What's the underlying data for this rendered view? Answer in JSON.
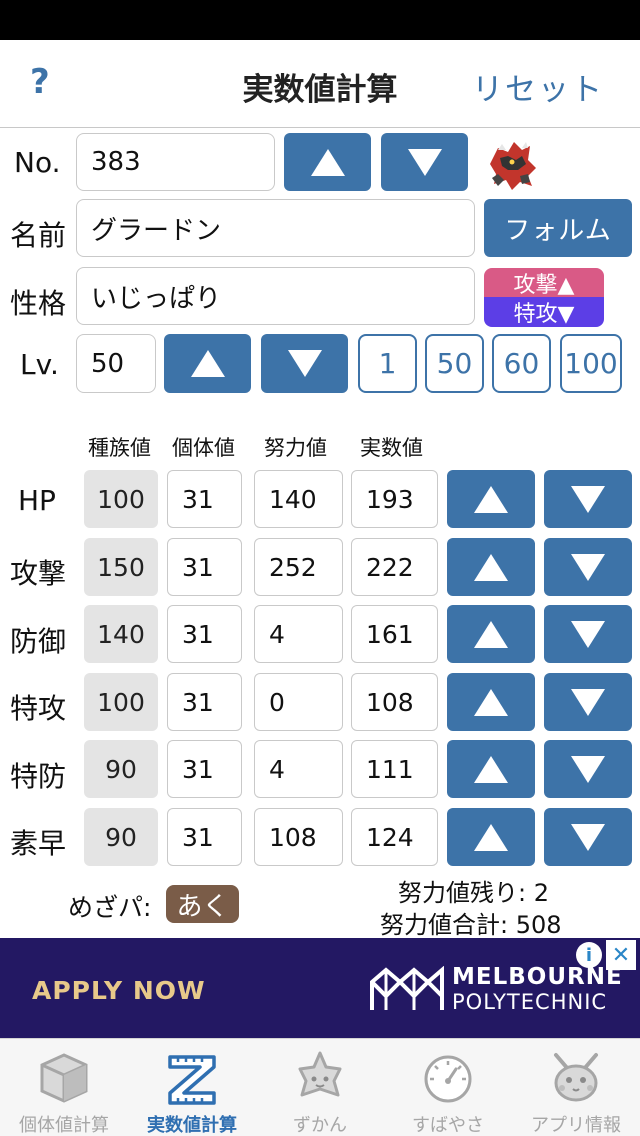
{
  "nav": {
    "help_label": "?",
    "title": "実数値計算",
    "reset_label": "リセット"
  },
  "form": {
    "no_label": "No.",
    "no_value": "383",
    "name_label": "名前",
    "name_value": "グラードン",
    "form_button_label": "フォルム",
    "nature_label": "性格",
    "nature_value": "いじっぱり",
    "nature_up": "攻撃▲",
    "nature_down": "特攻▼",
    "level_label": "Lv.",
    "level_value": "50",
    "level_presets": [
      "1",
      "50",
      "60",
      "100"
    ]
  },
  "columns": {
    "base": "種族値",
    "iv": "個体値",
    "ev": "努力値",
    "actual": "実数値"
  },
  "stats": [
    {
      "label": "HP",
      "base": "100",
      "iv": "31",
      "ev": "140",
      "actual": "193"
    },
    {
      "label": "攻撃",
      "base": "150",
      "iv": "31",
      "ev": "252",
      "actual": "222"
    },
    {
      "label": "防御",
      "base": "140",
      "iv": "31",
      "ev": "4",
      "actual": "161"
    },
    {
      "label": "特攻",
      "base": "100",
      "iv": "31",
      "ev": "0",
      "actual": "108"
    },
    {
      "label": "特防",
      "base": "90",
      "iv": "31",
      "ev": "4",
      "actual": "111"
    },
    {
      "label": "素早",
      "base": "90",
      "iv": "31",
      "ev": "108",
      "actual": "124"
    }
  ],
  "summary": {
    "hidden_power_label": "めざパ:",
    "hidden_power_type": "あく",
    "ev_remaining": "努力値残り: 2",
    "ev_total": "努力値合計: 508"
  },
  "ad": {
    "apply_text": "APPLY NOW",
    "brand_line1": "MELBOURNE",
    "brand_line2": "POLYTECHNIC",
    "info_icon": "i",
    "close_icon": "✕"
  },
  "tabs": [
    {
      "label": "個体値計算",
      "icon": "cube-icon",
      "active": false
    },
    {
      "label": "実数値計算",
      "icon": "z-ruler-icon",
      "active": true
    },
    {
      "label": "ずかん",
      "icon": "pokedex-icon",
      "active": false
    },
    {
      "label": "すばやさ",
      "icon": "speedometer-icon",
      "active": false
    },
    {
      "label": "アプリ情報",
      "icon": "pikachu-icon",
      "active": false
    }
  ],
  "colors": {
    "accent_blue": "#3d73a8",
    "nature_up": "#d95a86",
    "nature_down": "#5c3ee6",
    "hidden_power_badge": "#7a5c48",
    "ad_background": "#231863",
    "ad_apply_text": "#e8c98a",
    "tab_active": "#2f6fb1"
  }
}
